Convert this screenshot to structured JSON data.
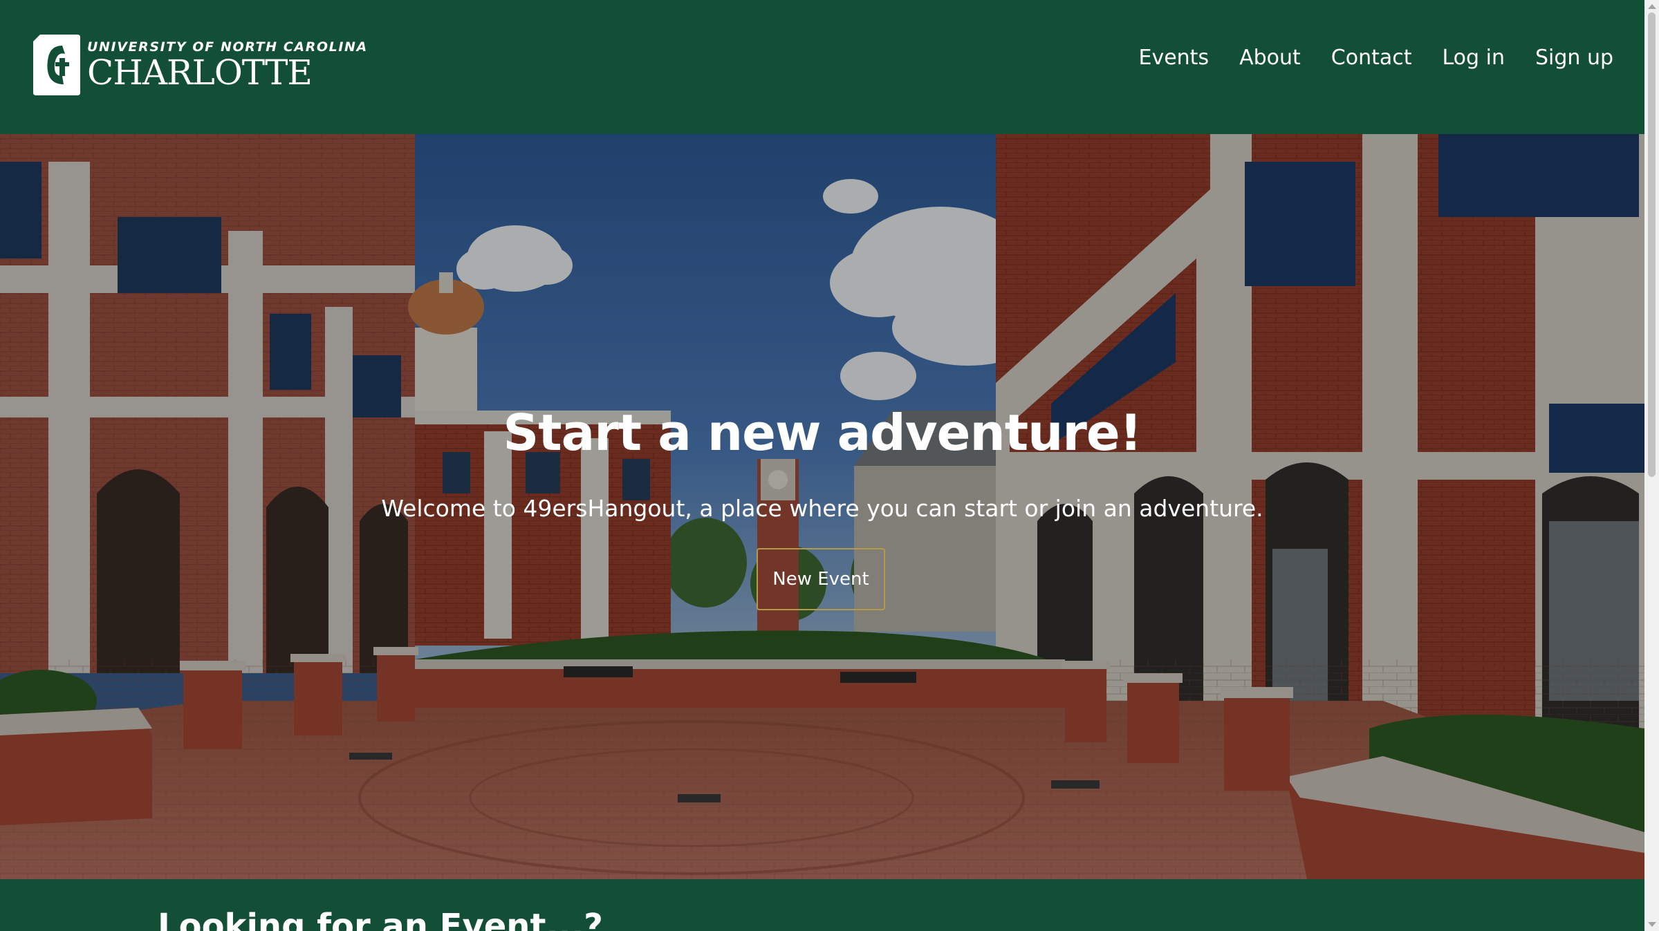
{
  "header": {
    "logo": {
      "line1": "UNIVERSITY OF NORTH CAROLINA",
      "line2": "CHARLOTTE"
    },
    "nav": [
      {
        "label": "Events"
      },
      {
        "label": "About"
      },
      {
        "label": "Contact"
      },
      {
        "label": "Log in"
      },
      {
        "label": "Sign up"
      }
    ]
  },
  "hero": {
    "title": "Start a new adventure!",
    "subtitle": "Welcome to 49ersHangout, a place where you can start or join an adventure.",
    "button_label": "New Event",
    "button_border_color": "#b59a4a"
  },
  "section": {
    "title": "Looking for an Event...?"
  },
  "colors": {
    "brand_green": "#124f36",
    "accent_gold": "#b59a4a"
  }
}
